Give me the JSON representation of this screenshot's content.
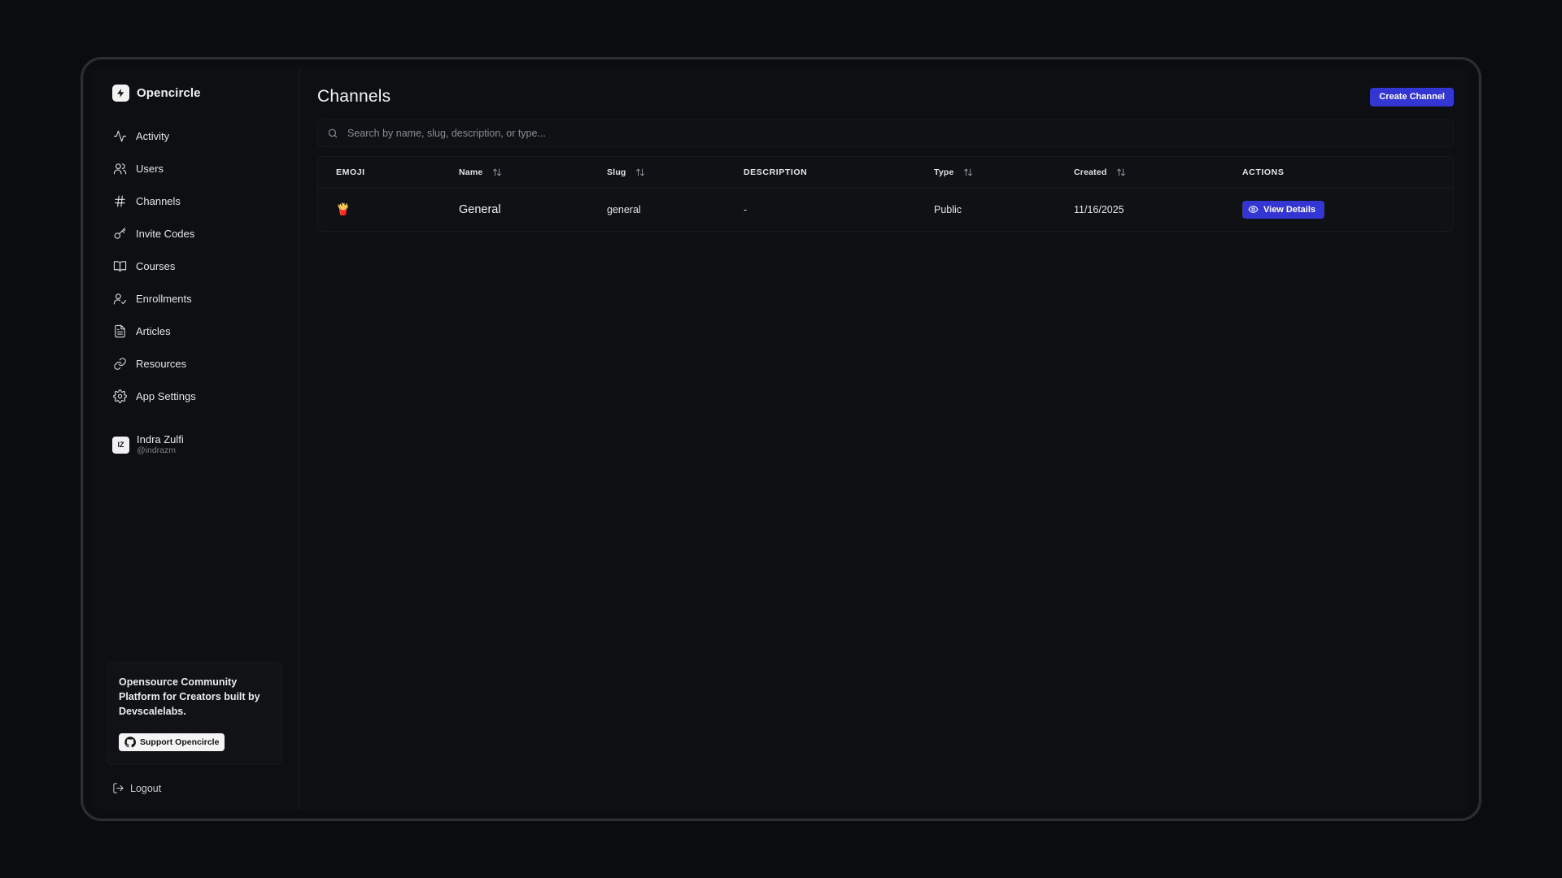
{
  "brand": {
    "name": "Opencircle",
    "logo_icon": "lightning-icon"
  },
  "sidebar": {
    "items": [
      {
        "label": "Activity",
        "icon": "activity-icon"
      },
      {
        "label": "Users",
        "icon": "users-icon"
      },
      {
        "label": "Channels",
        "icon": "hash-icon"
      },
      {
        "label": "Invite Codes",
        "icon": "key-icon"
      },
      {
        "label": "Courses",
        "icon": "book-icon"
      },
      {
        "label": "Enrollments",
        "icon": "user-check-icon"
      },
      {
        "label": "Articles",
        "icon": "file-text-icon"
      },
      {
        "label": "Resources",
        "icon": "link-icon"
      },
      {
        "label": "App Settings",
        "icon": "gear-icon"
      }
    ],
    "user": {
      "initials": "IZ",
      "name": "Indra Zulfi",
      "handle": "@indrazm"
    },
    "promo": {
      "text": "Opensource Community Platform for Creators built by Devscalelabs.",
      "button_label": "Support Opencircle",
      "button_icon": "github-icon"
    },
    "logout_label": "Logout"
  },
  "main": {
    "title": "Channels",
    "create_label": "Create Channel",
    "search": {
      "placeholder": "Search by name, slug, description, or type..."
    },
    "table": {
      "columns": [
        "EMOJI",
        "Name",
        "Slug",
        "DESCRIPTION",
        "Type",
        "Created",
        "ACTIONS"
      ],
      "rows": [
        {
          "emoji": "🍟",
          "name": "General",
          "slug": "general",
          "description": "-",
          "type": "Public",
          "created": "11/16/2025",
          "action": "View Details"
        }
      ]
    }
  },
  "colors": {
    "accent": "#3436d4",
    "background": "#0d0f12",
    "border": "#17191d"
  }
}
